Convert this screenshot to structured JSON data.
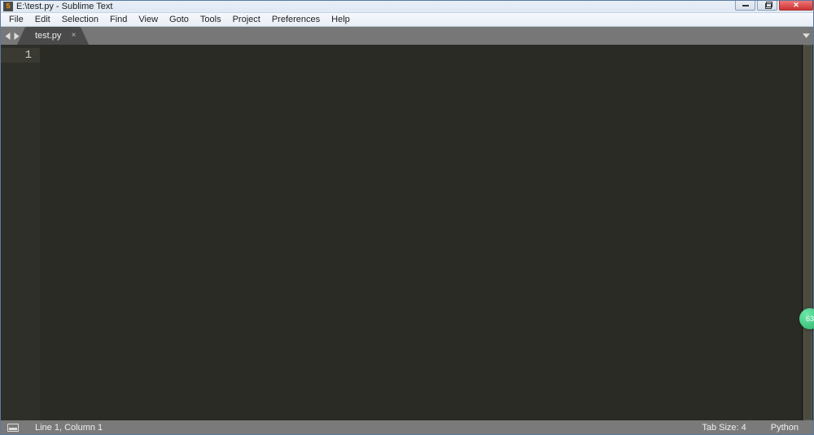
{
  "window": {
    "title": "E:\\test.py - Sublime Text",
    "app_icon_letter": "S"
  },
  "menu": {
    "items": [
      "File",
      "Edit",
      "Selection",
      "Find",
      "View",
      "Goto",
      "Tools",
      "Project",
      "Preferences",
      "Help"
    ]
  },
  "tabs": {
    "items": [
      {
        "label": "test.py"
      }
    ]
  },
  "editor": {
    "line_numbers": [
      "1"
    ]
  },
  "status": {
    "cursor": "Line 1, Column 1",
    "tab_size": "Tab Size: 4",
    "syntax": "Python"
  },
  "badge": {
    "text": "63"
  }
}
